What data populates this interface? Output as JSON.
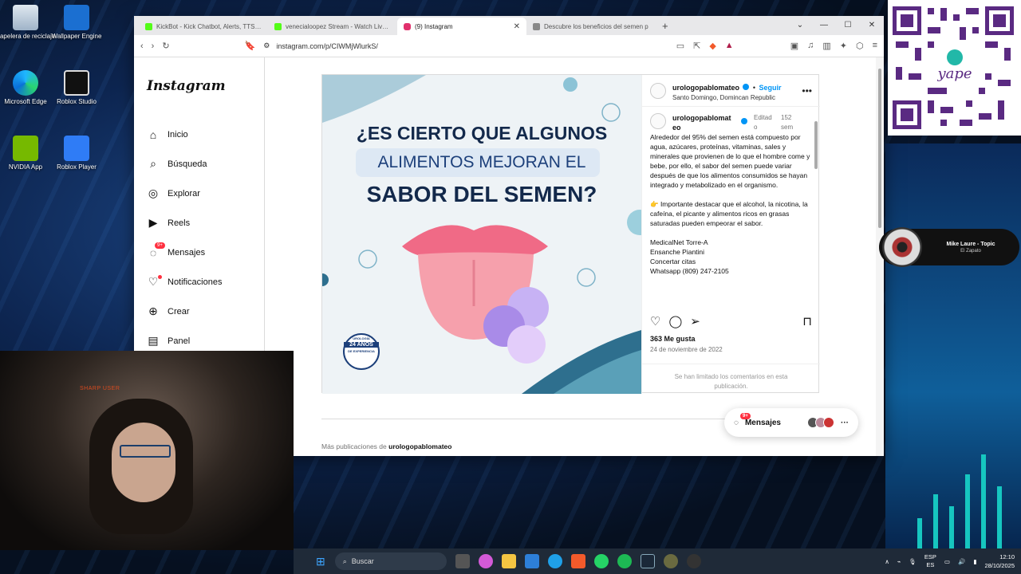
{
  "desktop": {
    "icons": [
      {
        "label": "Papelera de reciclaje"
      },
      {
        "label": "Wallpaper Engine"
      },
      {
        "label": "Microsoft Edge"
      },
      {
        "label": "Roblox Studio"
      },
      {
        "label": "NVIDIA App"
      },
      {
        "label": "Roblox Player"
      }
    ]
  },
  "browser": {
    "tabs": [
      {
        "label": "KickBot - Kick Chatbot, Alerts, TTS, O",
        "color": "#53fc18"
      },
      {
        "label": "venecialoopez Stream - Watch Live o",
        "color": "#53fc18"
      },
      {
        "label": "(9) Instagram",
        "color": "#e1306c"
      },
      {
        "label": "Descubre los beneficios del semen p",
        "color": "#888888"
      }
    ],
    "new_tab": "+",
    "url": "instagram.com/p/CIWMjWlurkS/"
  },
  "instagram": {
    "logo": "Instagram",
    "nav": [
      {
        "label": "Inicio",
        "icon": "home-icon"
      },
      {
        "label": "Búsqueda",
        "icon": "search-icon"
      },
      {
        "label": "Explorar",
        "icon": "compass-icon"
      },
      {
        "label": "Reels",
        "icon": "reels-icon"
      },
      {
        "label": "Mensajes",
        "icon": "messenger-icon",
        "badge": "9+"
      },
      {
        "label": "Notificaciones",
        "icon": "heart-icon"
      },
      {
        "label": "Crear",
        "icon": "plus-icon"
      },
      {
        "label": "Panel",
        "icon": "chart-icon"
      }
    ],
    "post": {
      "image_title": [
        "¿ES CIERTO QUE ALGUNOS",
        "ALIMENTOS MEJORAN EL",
        "SABOR DEL SEMEN?"
      ],
      "seal": [
        "UROLOGÍA",
        "24 AÑOS",
        "DE EXPERIENCIA"
      ],
      "author": "urologopablomateo",
      "follow": "Seguir",
      "location": "Santo Domingo, Domincan Republic",
      "caption_author": "urologopablomat eo",
      "edited": "Editad o",
      "time": "152 sem",
      "caption": [
        "Alrededor del 95% del semen está compuesto por agua, azúcares, proteínas, vitaminas, sales y minerales que provienen de lo que el hombre come y bebe, por ello, el sabor del semen puede variar después de que los alimentos consumidos se hayan integrado y metabolizado en el organismo.",
        "👉 Importante destacar que el alcohol, la nicotina, la cafeína, el picante y alimentos ricos en grasas saturadas pueden empeorar el sabor.",
        "MedicalNet  Torre-A",
        "Ensanche Piantini",
        "Concertar citas",
        "Whatsapp (809) 247-2105"
      ],
      "likes": "363 Me gusta",
      "date": "24 de noviembre de 2022",
      "comments_limited": "Se han limitado los comentarios en esta publicación."
    },
    "more_pubs_prefix": "Más publicaciones de",
    "more_pubs_user": "urologopablomateo",
    "messages_pill": {
      "label": "Mensajes",
      "badge": "9+"
    }
  },
  "webcam": {
    "overlay_text": "SHARP USER"
  },
  "qr": {
    "brand": "yape"
  },
  "now_playing": {
    "title": "Mike Laure - Topic",
    "subtitle": "El Zapato"
  },
  "taskbar": {
    "search": "Buscar",
    "lang": "ESP",
    "lang2": "ES",
    "time": "12:10",
    "date": "28/10/2025"
  }
}
